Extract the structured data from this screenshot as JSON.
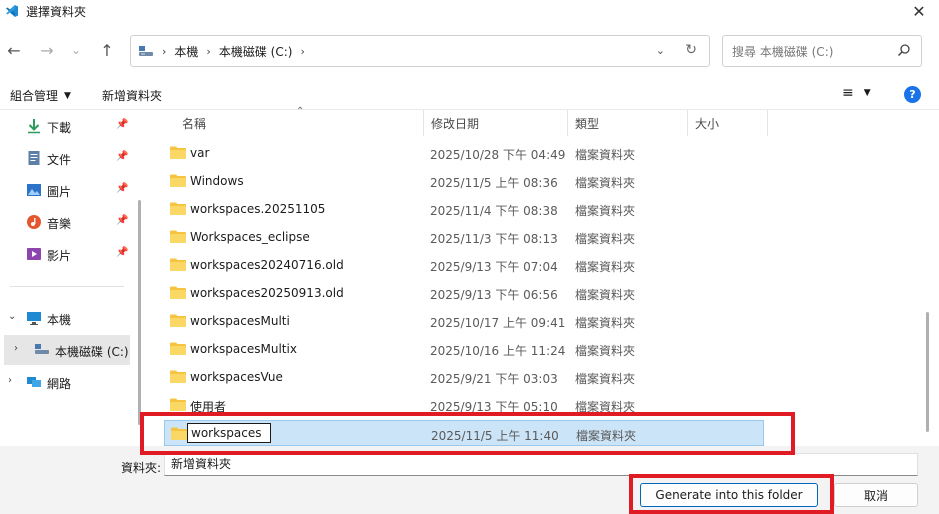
{
  "window": {
    "title": "選擇資料夾",
    "close_glyph": "✕"
  },
  "nav": {
    "back_glyph": "←",
    "forward_glyph": "→",
    "recent_glyph": "⌄",
    "up_glyph": "↑",
    "breadcrumb": [
      {
        "label": "本機"
      },
      {
        "label": "本機磁碟 (C:)"
      }
    ],
    "search_placeholder": "搜尋 本機磁碟 (C:)"
  },
  "toolbar": {
    "organize_label": "組合管理",
    "new_folder_label": "新增資料夾",
    "help_label": "?"
  },
  "sidebar": {
    "items": [
      {
        "label": "下載",
        "icon": "download-icon",
        "pinned": true
      },
      {
        "label": "文件",
        "icon": "document-icon",
        "pinned": true
      },
      {
        "label": "圖片",
        "icon": "picture-icon",
        "pinned": true
      },
      {
        "label": "音樂",
        "icon": "music-icon",
        "pinned": true
      },
      {
        "label": "影片",
        "icon": "video-icon",
        "pinned": true
      },
      {
        "label": "本機",
        "icon": "computer-icon",
        "expanded": true
      },
      {
        "label": "本機磁碟 (C:)",
        "icon": "drive-icon",
        "selected": true
      },
      {
        "label": "網路",
        "icon": "network-icon"
      }
    ]
  },
  "columns": {
    "name": "名稱",
    "modified": "修改日期",
    "type": "類型",
    "size": "大小"
  },
  "files": [
    {
      "name": "var",
      "modified": "2025/10/28 下午 04:49",
      "type": "檔案資料夾"
    },
    {
      "name": "Windows",
      "modified": "2025/11/5 上午 08:36",
      "type": "檔案資料夾"
    },
    {
      "name": "workspaces.20251105",
      "modified": "2025/11/4 下午 08:38",
      "type": "檔案資料夾"
    },
    {
      "name": "Workspaces_eclipse",
      "modified": "2025/11/3 下午 08:13",
      "type": "檔案資料夾"
    },
    {
      "name": "workspaces20240716.old",
      "modified": "2025/9/13 下午 07:04",
      "type": "檔案資料夾"
    },
    {
      "name": "workspaces20250913.old",
      "modified": "2025/9/13 下午 06:56",
      "type": "檔案資料夾"
    },
    {
      "name": "workspacesMulti",
      "modified": "2025/10/17 上午 09:41",
      "type": "檔案資料夾"
    },
    {
      "name": "workspacesMultix",
      "modified": "2025/10/16 上午 11:24",
      "type": "檔案資料夾"
    },
    {
      "name": "workspacesVue",
      "modified": "2025/9/21 下午 03:03",
      "type": "檔案資料夾"
    },
    {
      "name": "使用者",
      "modified": "2025/9/13 下午 05:10",
      "type": "檔案資料夾"
    }
  ],
  "selected_file": {
    "name": "workspaces",
    "modified": "2025/11/5 上午 11:40",
    "type": "檔案資料夾"
  },
  "bottom": {
    "folder_label": "資料夾:",
    "folder_value": "新增資料夾",
    "generate_label": "Generate into this folder",
    "cancel_label": "取消"
  },
  "colors": {
    "highlight": "#e01b24",
    "selection": "#cce4f7",
    "folder": "#f5c542",
    "accent": "#0067c0"
  }
}
